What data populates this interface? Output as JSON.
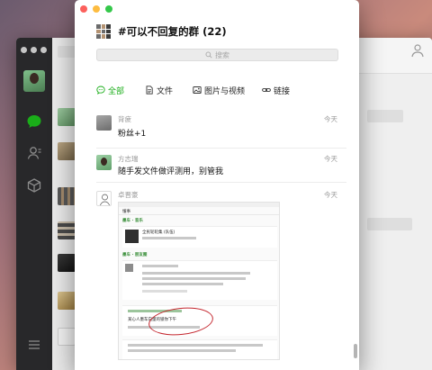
{
  "background_window": {
    "sidebar_icons": [
      "chat-icon",
      "contacts-icon",
      "favorites-icon",
      "menu-icon"
    ],
    "accent": "#1aad19"
  },
  "window": {
    "title": "#可以不回复的群 (22)",
    "search_placeholder": "搜索"
  },
  "tabs": [
    {
      "label": "全部",
      "icon": "chat-bubble-icon",
      "active": true
    },
    {
      "label": "文件",
      "icon": "file-icon",
      "active": false
    },
    {
      "label": "图片与视频",
      "icon": "image-icon",
      "active": false
    },
    {
      "label": "链接",
      "icon": "link-icon",
      "active": false
    }
  ],
  "messages": [
    {
      "name": "背疲",
      "time": "今天",
      "text": "粉丝+1"
    },
    {
      "name": "方志瑞",
      "time": "今天",
      "text": "随手发文件做评测用，别管我"
    },
    {
      "name": "卓晋豪",
      "time": "今天",
      "text": ""
    }
  ],
  "shared_image": {
    "nav_title": "懂事",
    "sections": [
      "墨车 · 音乐",
      "墨车 · 朋友圈"
    ],
    "music_title": "全民轮轮集 (队伍)",
    "highlight_text": "某心人墨车向量的锁你下午"
  }
}
